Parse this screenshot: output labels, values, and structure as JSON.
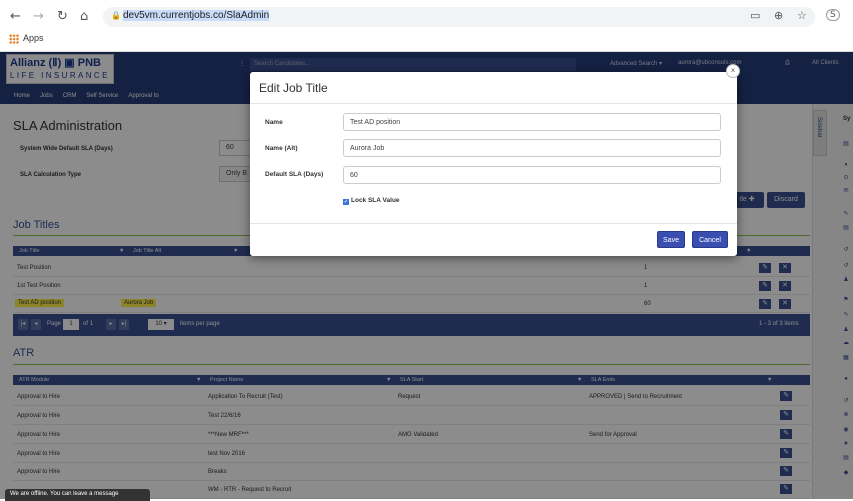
{
  "browser": {
    "url": "dev5vm.currentjobs.co/SlaAdmin",
    "bookmark_apps": "Apps"
  },
  "header": {
    "logo_line1": "Allianz (Ⅱ) ▣ PNB",
    "logo_line2": "LIFE INSURANCE",
    "search_placeholder": "Search Candidates...",
    "advanced_search": "Advanced Search ▾",
    "user": "aurora@ubconsuls.com",
    "all_clients": "All Clients"
  },
  "nav": [
    "Home",
    "Jobs",
    "CRM",
    "Self Service",
    "Approval to"
  ],
  "page": {
    "title": "SLA Administration",
    "default_sla_label": "System Wide Default SLA (Days)",
    "default_sla_value": "60",
    "calc_type_label": "SLA Calculation Type",
    "calc_type_value": "Only B",
    "add_button": "tle",
    "discard_button": "Discard"
  },
  "job_titles": {
    "heading": "Job Titles",
    "columns": [
      "Job Title",
      "Job Title Alt"
    ],
    "rows": [
      {
        "title": "Test Position",
        "alt": "",
        "sla": "1"
      },
      {
        "title": "1st Test Position",
        "alt": "",
        "sla": "1"
      },
      {
        "title": "Test AD position",
        "alt": "Aurora Job",
        "sla": "60"
      }
    ],
    "pager": {
      "page_label": "Page",
      "page": "1",
      "of": "of 1",
      "per_page": "10",
      "per_page_label": "items per page",
      "summary": "1 - 3 of 3 items"
    }
  },
  "atr": {
    "heading": "ATR",
    "columns": [
      "ATR Module",
      "Project Name",
      "SLA Start",
      "SLA Ends"
    ],
    "rows": [
      {
        "module": "Approval to Hire",
        "project": "Application To Recruit (Test)",
        "start": "Request",
        "ends": "APPROVED | Send to Recruitment"
      },
      {
        "module": "Approval to Hire",
        "project": "Test 22/6/16",
        "start": "",
        "ends": ""
      },
      {
        "module": "Approval to Hire",
        "project": "***New MRF***",
        "start": "AMG Validated",
        "ends": "Send for Approval"
      },
      {
        "module": "Approval to Hire",
        "project": "test Nov 2016",
        "start": "",
        "ends": ""
      },
      {
        "module": "Approval to Hire",
        "project": "Breaks",
        "start": "",
        "ends": ""
      },
      {
        "module": "",
        "project": "WM - RTR - Request to Recruit",
        "start": "",
        "ends": ""
      }
    ]
  },
  "sidebar": {
    "tab_label": "Sidebar",
    "top_label": "Sy"
  },
  "modal": {
    "title": "Edit Job Title",
    "name_label": "Name",
    "name_value": "Test AD position",
    "alt_label": "Name (Alt)",
    "alt_value": "Aurora  Job",
    "sla_label": "Default SLA (Days)",
    "sla_value": "60",
    "lock_label": "Lock SLA Value",
    "save": "Save",
    "cancel": "Cancel"
  },
  "chat": "We are offline. You can leave a message"
}
